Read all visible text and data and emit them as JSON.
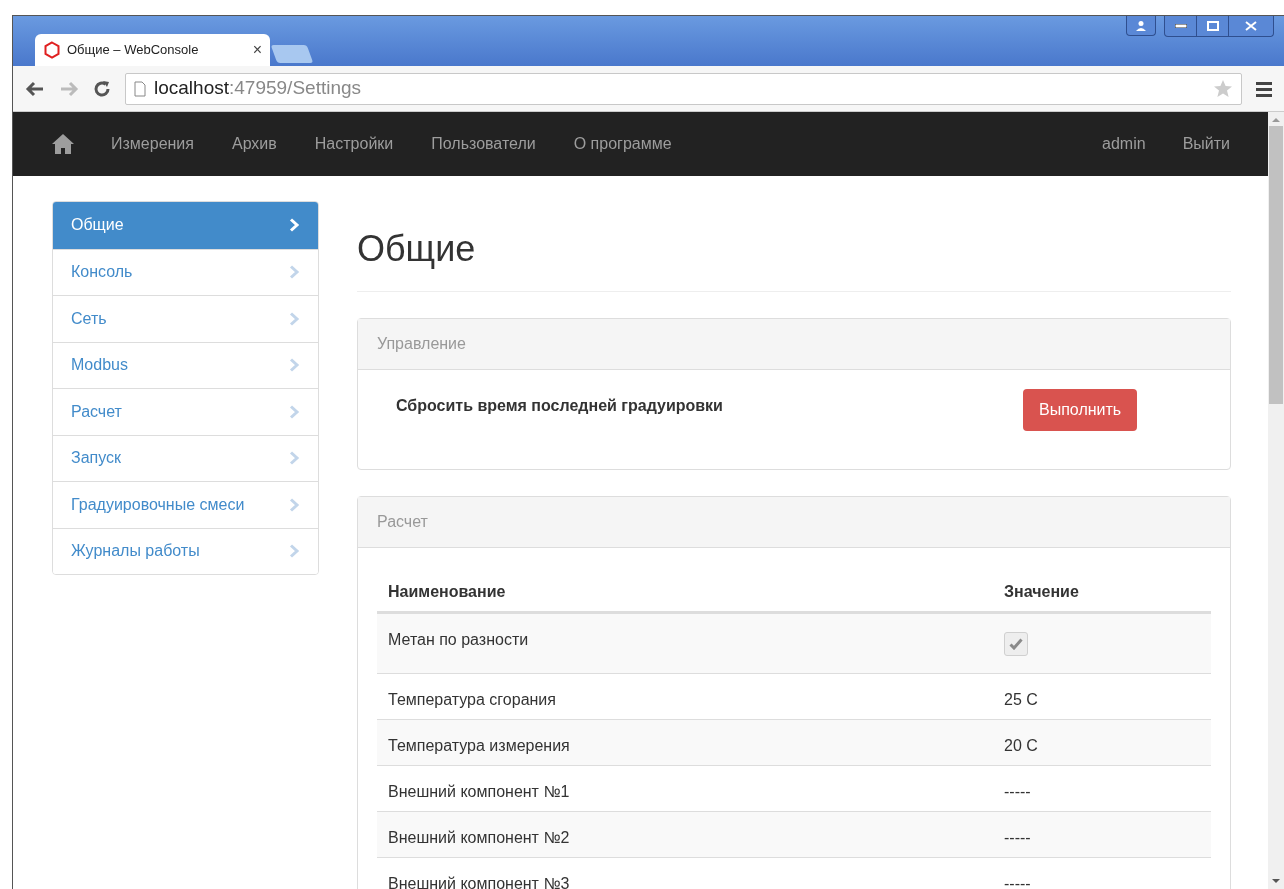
{
  "browser": {
    "tab_title": "Общие – WebConsole",
    "tab_close": "×",
    "url_host": "localhost",
    "url_path": ":47959/Settings"
  },
  "navbar": {
    "items": [
      {
        "label": "Измерения"
      },
      {
        "label": "Архив"
      },
      {
        "label": "Настройки"
      },
      {
        "label": "Пользователи"
      },
      {
        "label": "О программе"
      }
    ],
    "user": "admin",
    "logout": "Выйти"
  },
  "sidebar": {
    "items": [
      {
        "label": "Общие",
        "selected": true
      },
      {
        "label": "Консоль",
        "selected": false
      },
      {
        "label": "Сеть",
        "selected": false
      },
      {
        "label": "Modbus",
        "selected": false
      },
      {
        "label": "Расчет",
        "selected": false
      },
      {
        "label": "Запуск",
        "selected": false
      },
      {
        "label": "Градуировочные смеси",
        "selected": false
      },
      {
        "label": "Журналы работы",
        "selected": false
      }
    ]
  },
  "page_title": "Общие",
  "control_panel": {
    "title": "Управление",
    "action_label": "Сбросить время последней градуировки",
    "button": "Выполнить"
  },
  "calc_panel": {
    "title": "Расчет",
    "columns": [
      "Наименование",
      "Значение"
    ],
    "rows": [
      {
        "name": "Метан по разности",
        "kind": "checkbox",
        "checked": true
      },
      {
        "name": "Температура сгорания",
        "kind": "text",
        "value": "25 C"
      },
      {
        "name": "Температура измерения",
        "kind": "text",
        "value": "20 C"
      },
      {
        "name": "Внешний компонент №1",
        "kind": "text",
        "value": "-----"
      },
      {
        "name": "Внешний компонент №2",
        "kind": "text",
        "value": "-----"
      },
      {
        "name": "Внешний компонент №3",
        "kind": "text",
        "value": "-----"
      }
    ]
  }
}
